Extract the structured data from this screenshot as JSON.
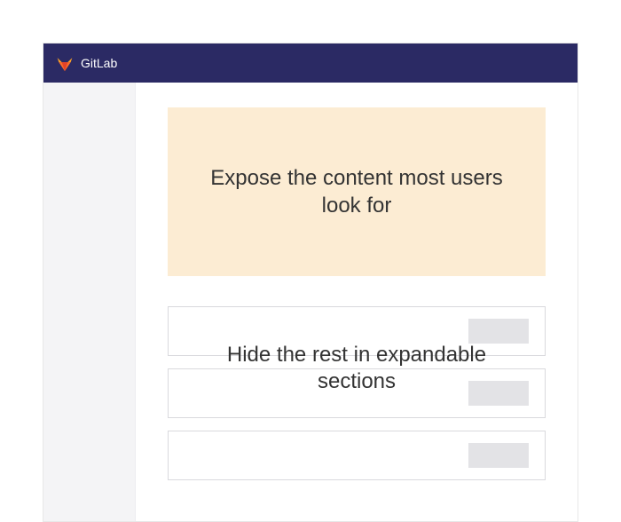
{
  "header": {
    "brand": "GitLab"
  },
  "annotations": {
    "hero": "Expose the content most users look for",
    "sections": "Hide the rest in expandable sections"
  }
}
